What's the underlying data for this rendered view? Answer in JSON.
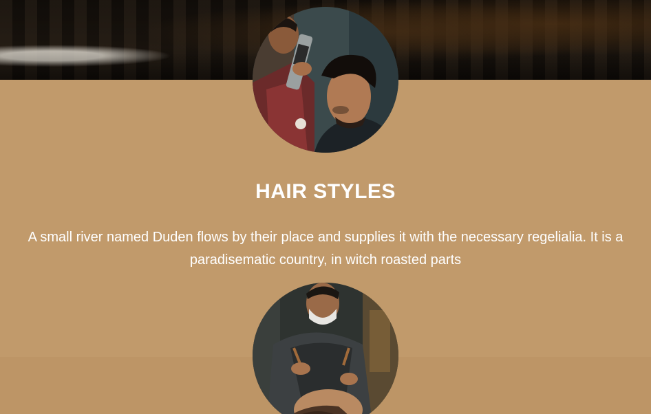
{
  "hero": {
    "image": "barbershop-background-image"
  },
  "services": [
    {
      "image": "hairspray-styling-photo",
      "title": "HAIR STYLES",
      "description": "A small river named Duden flows by their place and supplies it with the necessary regelialia. It is a paradisematic country, in witch roasted parts"
    },
    {
      "image": "beard-trim-photo"
    }
  ],
  "colors": {
    "section_background": "#c19a6b",
    "lower_band": "#bd9566",
    "text": "#ffffff"
  }
}
